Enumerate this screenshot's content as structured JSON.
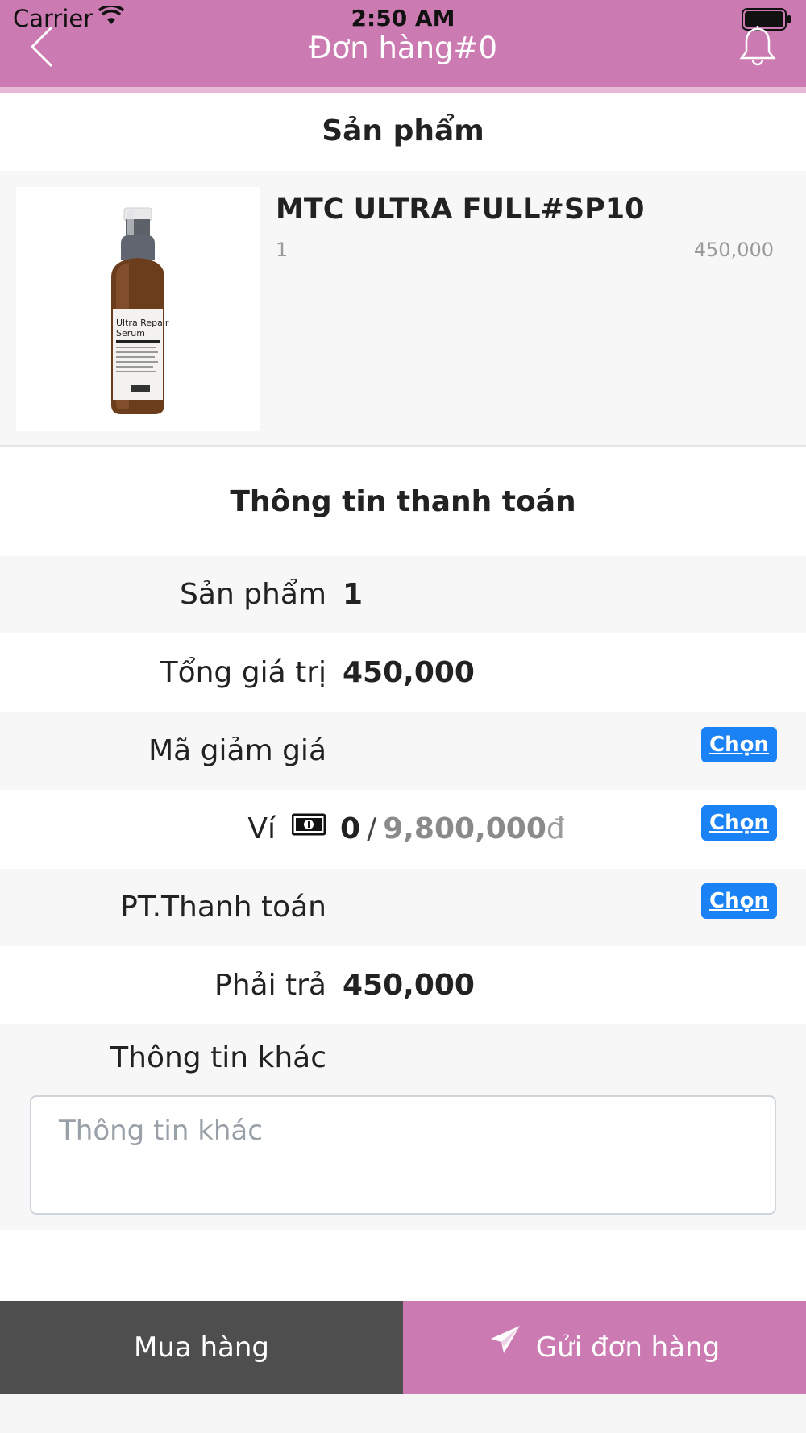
{
  "status_bar": {
    "carrier": "Carrier",
    "time": "2:50 AM"
  },
  "header": {
    "title": "Đơn hàng#0",
    "color": "#cc7bb2"
  },
  "product_section": {
    "title": "Sản phẩm",
    "item": {
      "name": "MTC ULTRA FULL#SP10",
      "quantity": "1",
      "price": "450,000",
      "image_label_line1": "Ultra Repair",
      "image_label_line2": "Serum"
    }
  },
  "payment_section": {
    "title": "Thông tin thanh toán",
    "rows": {
      "products": {
        "label": "Sản phẩm",
        "value": "1"
      },
      "total": {
        "label": "Tổng giá trị",
        "value": "450,000"
      },
      "discount": {
        "label": "Mã giảm giá",
        "button": "Chọn"
      },
      "wallet": {
        "label": "Ví",
        "current": "0",
        "separator": "/",
        "max": "9,800,000",
        "unit": "đ",
        "button": "Chọn"
      },
      "method": {
        "label": "PT.Thanh toán",
        "button": "Chọn"
      },
      "pay": {
        "label": "Phải trả",
        "value": "450,000"
      }
    },
    "other_info": {
      "label": "Thông tin khác",
      "placeholder": "Thông tin khác",
      "value": ""
    }
  },
  "actions": {
    "buy_label": "Mua hàng",
    "send_label": "Gửi đơn hàng"
  },
  "colors": {
    "accent": "#cc7bb2",
    "button_blue": "#1a82f4",
    "dark_button": "#4e4e4f"
  }
}
